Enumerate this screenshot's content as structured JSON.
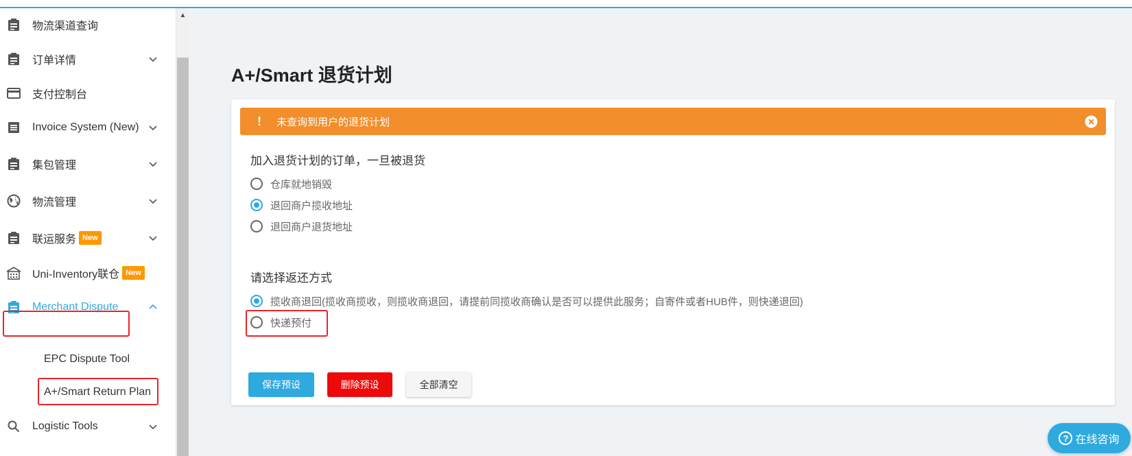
{
  "sidebar": {
    "items": [
      {
        "label": "物流渠道查询",
        "icon": "clipboard-icon"
      },
      {
        "label": "订单详情",
        "icon": "clipboard-icon"
      },
      {
        "label": "支付控制台",
        "icon": "credit-card-icon"
      },
      {
        "label": "Invoice System (New)",
        "icon": "list-icon"
      },
      {
        "label": "集包管理",
        "icon": "clipboard-icon"
      },
      {
        "label": "物流管理",
        "icon": "globe-icon"
      },
      {
        "label": "联运服务",
        "icon": "clipboard-icon",
        "badge": "New"
      },
      {
        "label": "Uni-Inventory联仓",
        "icon": "warehouse-icon",
        "badge": "New"
      },
      {
        "label": "Merchant Dispute",
        "icon": "clipboard-icon"
      },
      {
        "label": "Logistic Tools",
        "icon": "search-icon"
      }
    ],
    "sub_items": [
      {
        "label": "EPC Dispute Tool"
      },
      {
        "label": "A+/Smart Return Plan"
      }
    ]
  },
  "main": {
    "title": "A+/Smart 退货计划",
    "alert": {
      "text": "未查询到用户的退货计划",
      "bang": "!"
    },
    "section1": {
      "label": "加入退货计划的订单，一旦被退货",
      "options": [
        {
          "label": "仓库就地销毁",
          "checked": false
        },
        {
          "label": "退回商户揽收地址",
          "checked": true
        },
        {
          "label": "退回商户退货地址",
          "checked": false
        }
      ]
    },
    "section2": {
      "label": "请选择返还方式",
      "options": [
        {
          "label": "揽收商退回(揽收商揽收，则揽收商退回，请提前同揽收商确认是否可以提供此服务；自寄件或者HUB件，则快递退回)",
          "checked": true
        },
        {
          "label": "快递预付",
          "checked": false
        }
      ]
    },
    "buttons": {
      "save": "保存预设",
      "delete": "删除预设",
      "clear": "全部清空"
    }
  },
  "chat": {
    "label": "在线咨询",
    "icon_glyph": "?"
  },
  "colors": {
    "accent": "#2eaadf",
    "warning": "#f28e2b",
    "danger": "#ee0a0a",
    "badge": "#ff9800",
    "highlight": "#e8242a"
  }
}
